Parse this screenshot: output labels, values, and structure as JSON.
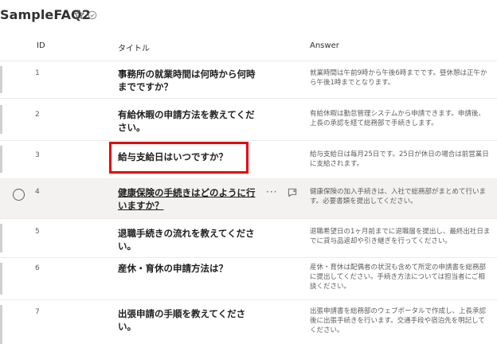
{
  "list": {
    "title": "SampleFAQ2"
  },
  "columns": {
    "id": "ID",
    "title": "タイトル",
    "answer": "Answer"
  },
  "rows": [
    {
      "id": "1",
      "title": "事務所の就業時間は何時から何時までですか？",
      "answer": "就業時間は午前9時から午後6時までです。昼休憩は正午から午後1時までとなります。"
    },
    {
      "id": "2",
      "title": "有給休暇の申請方法を教えてください。",
      "answer": "有給休暇は勤怠管理システムから申請できます。申請後、上長の承認を経て総務部で手続きします。"
    },
    {
      "id": "3",
      "title": "給与支給日はいつですか？",
      "answer": "給与支給日は毎月25日です。25日が休日の場合は前営業日に支給されます。"
    },
    {
      "id": "4",
      "title": "健康保険の手続きはどのように行いますか？",
      "answer": "健康保険の加入手続きは、入社で総務部がまとめて行います。必要書類を提出してください。"
    },
    {
      "id": "5",
      "title": "退職手続きの流れを教えてください。",
      "answer": "退職希望日の1ヶ月前までに退職届を提出し、最終出社日までに貸与品返却や引き継ぎを行ってください。"
    },
    {
      "id": "6",
      "title": "産休・育休の申請方法は？",
      "answer": "産休・育休は配偶者の状況も含めて所定の申請書を総務部に提出してください。手続き方法については担当者にご相談ください。"
    },
    {
      "id": "7",
      "title": "出張申請の手順を教えてください。",
      "answer": "出張申請書を総務部のウェブポータルで作成し、上長承認後に出張手続きを行います。交通手段や宿泊先を明記してください。"
    }
  ],
  "colors": {
    "highlight": "#e8000b",
    "selected_row": "#f3f2f1"
  },
  "icons": {
    "favorite": "star-icon",
    "status": "check-circle-icon",
    "row_select": "radio-icon",
    "more": "more-icon",
    "comment": "comment-icon"
  }
}
